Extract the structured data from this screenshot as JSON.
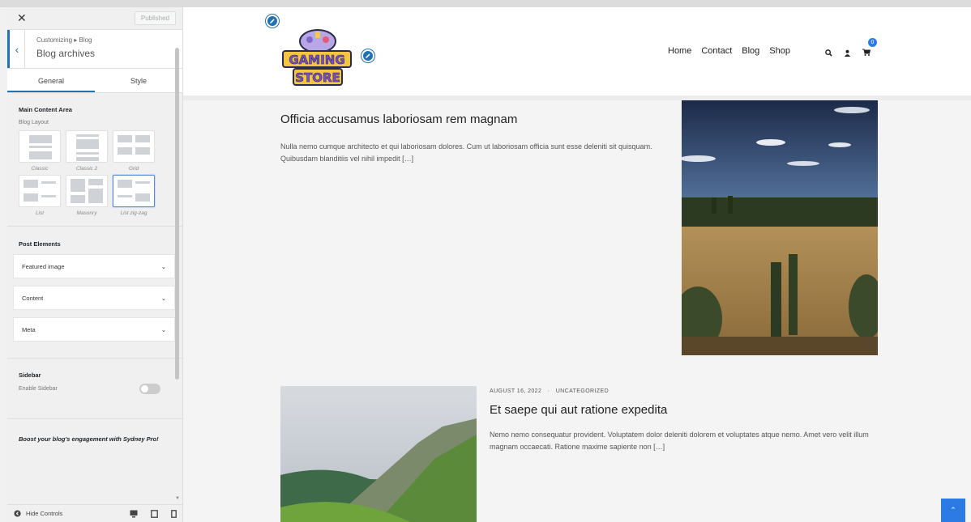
{
  "customizer": {
    "close_label": "✕",
    "publish_label": "Published",
    "breadcrumb_small": "Customizing ▸ Blog",
    "breadcrumb_title": "Blog archives",
    "tabs": [
      {
        "label": "General",
        "active": true
      },
      {
        "label": "Style",
        "active": false
      }
    ],
    "main_content_heading": "Main Content Area",
    "blog_layout_label": "Blog Layout",
    "layouts": [
      {
        "name": "Classic",
        "selected": false
      },
      {
        "name": "Classic 2",
        "selected": false
      },
      {
        "name": "Grid",
        "selected": false
      },
      {
        "name": "List",
        "selected": false
      },
      {
        "name": "Masonry",
        "selected": false
      },
      {
        "name": "List zig-zag",
        "selected": true
      }
    ],
    "post_elements_heading": "Post Elements",
    "post_elements": [
      "Featured image",
      "Content",
      "Meta"
    ],
    "sidebar_heading": "Sidebar",
    "enable_sidebar_label": "Enable Sidebar",
    "enable_sidebar_on": false,
    "promo_text": "Boost your blog's engagement with Sydney Pro!",
    "hide_controls_label": "Hide Controls"
  },
  "site": {
    "logo_line1": "GAMING",
    "logo_line2": "STORE",
    "nav": [
      "Home",
      "Contact",
      "Blog",
      "Shop"
    ],
    "cart_count": "0",
    "posts": [
      {
        "title": "Officia accusamus laboriosam rem magnam",
        "excerpt": "Nulla nemo cumque architecto et qui laboriosam dolores. Cum ut laboriosam officia sunt esse deleniti sit quisquam. Quibusdam blanditiis vel nihil impedit […]"
      },
      {
        "date": "AUGUST 16, 2022",
        "separator": "·",
        "category": "UNCATEGORIZED",
        "title": "Et saepe qui aut ratione expedita",
        "excerpt": "Nemo nemo consequatur provident. Voluptatem dolor deleniti dolorem et voluptates atque nemo. Amet vero velit illum magnam occaecati. Ratione maxime sapiente non […]"
      }
    ]
  },
  "colors": {
    "accent": "#2271b1",
    "scroll_top": "#2c7be5"
  }
}
